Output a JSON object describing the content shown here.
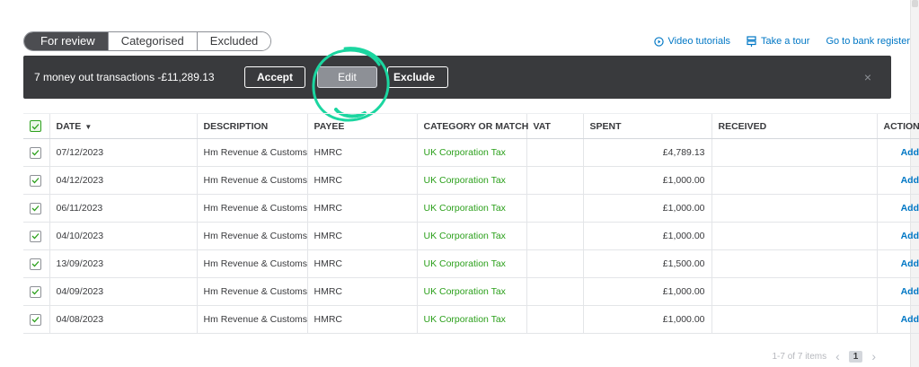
{
  "tabs": [
    {
      "label": "For review",
      "active": true
    },
    {
      "label": "Categorised",
      "active": false
    },
    {
      "label": "Excluded",
      "active": false
    }
  ],
  "toplinks": {
    "video": "Video tutorials",
    "tour": "Take a tour",
    "register": "Go to bank register"
  },
  "actionbar": {
    "summary": "7 money out transactions -£11,289.13",
    "accept": "Accept",
    "edit": "Edit",
    "exclude": "Exclude",
    "close": "×"
  },
  "table": {
    "headers": {
      "date": "DATE",
      "sort_indicator": "▼",
      "description": "DESCRIPTION",
      "payee": "PAYEE",
      "category": "CATEGORY OR MATCH",
      "vat": "VAT",
      "spent": "SPENT",
      "received": "RECEIVED",
      "action": "ACTION"
    },
    "rows": [
      {
        "date": "07/12/2023",
        "description": "Hm Revenue & Customs",
        "payee": "HMRC",
        "category": "UK Corporation Tax",
        "vat": "",
        "spent": "£4,789.13",
        "received": "",
        "action": "Add"
      },
      {
        "date": "04/12/2023",
        "description": "Hm Revenue & Customs",
        "payee": "HMRC",
        "category": "UK Corporation Tax",
        "vat": "",
        "spent": "£1,000.00",
        "received": "",
        "action": "Add"
      },
      {
        "date": "06/11/2023",
        "description": "Hm Revenue & Customs",
        "payee": "HMRC",
        "category": "UK Corporation Tax",
        "vat": "",
        "spent": "£1,000.00",
        "received": "",
        "action": "Add"
      },
      {
        "date": "04/10/2023",
        "description": "Hm Revenue & Customs",
        "payee": "HMRC",
        "category": "UK Corporation Tax",
        "vat": "",
        "spent": "£1,000.00",
        "received": "",
        "action": "Add"
      },
      {
        "date": "13/09/2023",
        "description": "Hm Revenue & Customs",
        "payee": "HMRC",
        "category": "UK Corporation Tax",
        "vat": "",
        "spent": "£1,500.00",
        "received": "",
        "action": "Add"
      },
      {
        "date": "04/09/2023",
        "description": "Hm Revenue & Customs",
        "payee": "HMRC",
        "category": "UK Corporation Tax",
        "vat": "",
        "spent": "£1,000.00",
        "received": "",
        "action": "Add"
      },
      {
        "date": "04/08/2023",
        "description": "Hm Revenue & Customs",
        "payee": "HMRC",
        "category": "UK Corporation Tax",
        "vat": "",
        "spent": "£1,000.00",
        "received": "",
        "action": "Add"
      }
    ]
  },
  "pager": {
    "summary": "1-7 of 7 items",
    "prev": "‹",
    "page": "1",
    "next": "›"
  },
  "colors": {
    "accent_blue": "#0077c5",
    "category_green": "#2ca01c",
    "actionbar_bg": "#393a3d",
    "annotation": "#1bd6a0"
  }
}
